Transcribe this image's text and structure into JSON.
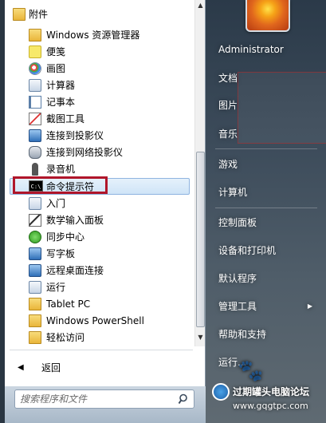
{
  "programs": {
    "items": [
      {
        "label": "附件",
        "icon": "folder-open-icon"
      },
      {
        "label": "Windows 资源管理器",
        "icon": "explorer-icon"
      },
      {
        "label": "便笺",
        "icon": "sticky-notes-icon"
      },
      {
        "label": "画图",
        "icon": "paint-icon"
      },
      {
        "label": "计算器",
        "icon": "calculator-icon"
      },
      {
        "label": "记事本",
        "icon": "notepad-icon"
      },
      {
        "label": "截图工具",
        "icon": "snipping-tool-icon"
      },
      {
        "label": "连接到投影仪",
        "icon": "projector-icon"
      },
      {
        "label": "连接到网络投影仪",
        "icon": "network-projector-icon"
      },
      {
        "label": "录音机",
        "icon": "microphone-icon"
      },
      {
        "label": "命令提示符",
        "icon": "cmd-icon"
      },
      {
        "label": "入门",
        "icon": "getting-started-icon"
      },
      {
        "label": "数学输入面板",
        "icon": "math-input-icon"
      },
      {
        "label": "同步中心",
        "icon": "sync-center-icon"
      },
      {
        "label": "写字板",
        "icon": "wordpad-icon"
      },
      {
        "label": "远程桌面连接",
        "icon": "remote-desktop-icon"
      },
      {
        "label": "运行",
        "icon": "run-icon"
      },
      {
        "label": "Tablet PC",
        "icon": "folder-icon"
      },
      {
        "label": "Windows PowerShell",
        "icon": "folder-icon"
      },
      {
        "label": "轻松访问",
        "icon": "folder-icon"
      }
    ],
    "selected_index": 10,
    "cmd_glyph": "C:\\"
  },
  "back": {
    "label": "返回",
    "icon": "back-triangle-icon"
  },
  "search": {
    "placeholder": "搜索程序和文件",
    "icon": "search-icon"
  },
  "right_menu": {
    "items": [
      {
        "label": "Administrator"
      },
      {
        "label": "文档"
      },
      {
        "label": "图片"
      },
      {
        "label": "音乐"
      },
      {
        "label": "游戏"
      },
      {
        "label": "计算机"
      },
      {
        "label": "控制面板"
      },
      {
        "label": "设备和打印机"
      },
      {
        "label": "默认程序"
      },
      {
        "label": "管理工具",
        "submenu": true
      },
      {
        "label": "帮助和支持"
      },
      {
        "label": "运行..."
      }
    ],
    "submenu_arrow": "▶"
  },
  "watermark": {
    "title": "过期罐头电脑论坛",
    "url": "www.gqgtpc.com",
    "paw": "🐾"
  },
  "scroll": {
    "up": "▲",
    "down": "▼"
  },
  "colors": {
    "highlight_border": "#b0162a",
    "selection_fill": "#cfe4f7",
    "right_pane": "#3d4c5b"
  }
}
